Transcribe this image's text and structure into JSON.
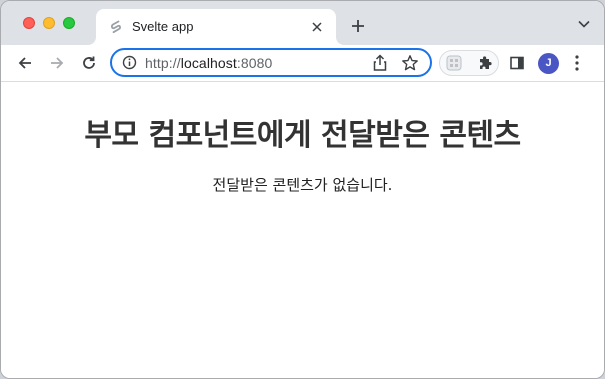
{
  "browser": {
    "tab": {
      "title": "Svelte app",
      "favicon": "svelte-logo-icon"
    },
    "address": {
      "scheme": "http://",
      "host": "localhost",
      "port": ":8080"
    },
    "profile_initial": "J",
    "accent_color": "#1a73e8",
    "avatar_color": "#4a56c4"
  },
  "page": {
    "heading": "부모 컴포넌트에게 전달받은 콘텐츠",
    "message": "전달받은 콘텐츠가 없습니다."
  }
}
